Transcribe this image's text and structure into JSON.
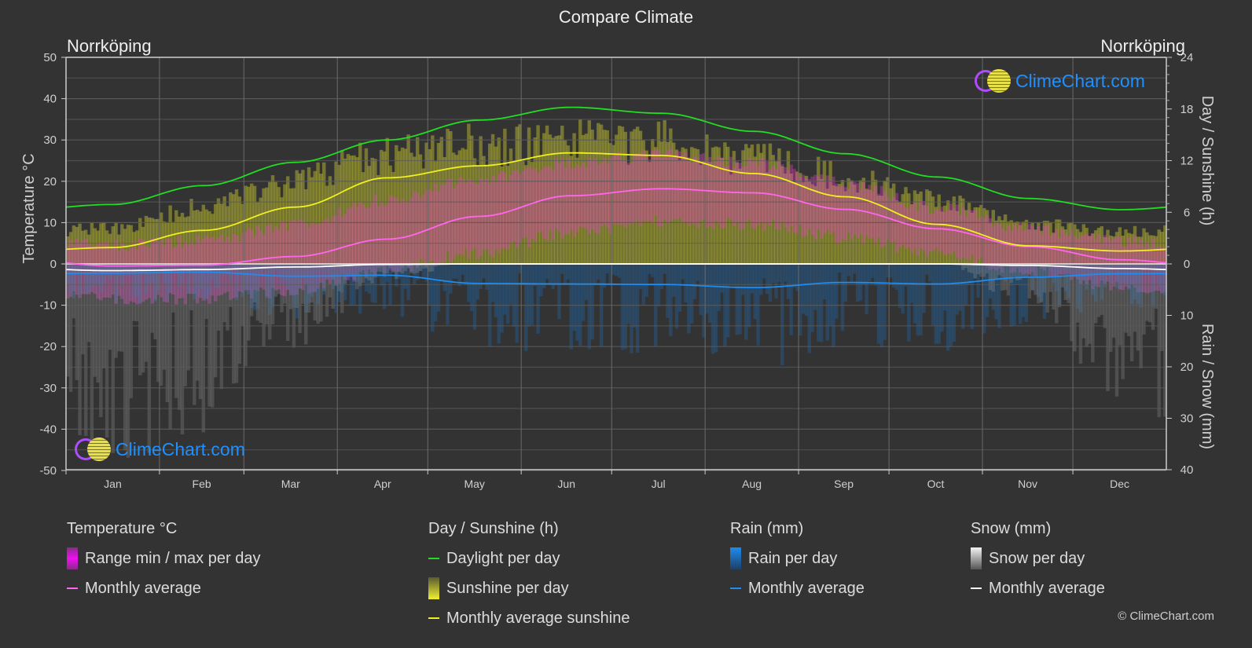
{
  "page": {
    "title": "Compare Climate",
    "location_left": "Norrköping",
    "location_right": "Norrköping",
    "logo_text": "ClimeChart.com",
    "copyright": "© ClimeChart.com"
  },
  "legend": {
    "temperature": {
      "header": "Temperature °C",
      "items": [
        {
          "label": "Range min / max per day",
          "kind": "bar",
          "color": "#e619e6"
        },
        {
          "label": "Monthly average",
          "kind": "line",
          "color": "#ff66ee"
        }
      ]
    },
    "sunshine": {
      "header": "Day / Sunshine (h)",
      "items": [
        {
          "label": "Daylight per day",
          "kind": "line",
          "color": "#22dd22"
        },
        {
          "label": "Sunshine per day",
          "kind": "bar",
          "color": "#e6e630"
        },
        {
          "label": "Monthly average sunshine",
          "kind": "line",
          "color": "#f0f020"
        }
      ]
    },
    "rain": {
      "header": "Rain (mm)",
      "items": [
        {
          "label": "Rain per day",
          "kind": "bar",
          "color": "#1e8cf0"
        },
        {
          "label": "Monthly average",
          "kind": "line",
          "color": "#1e8cf0"
        }
      ]
    },
    "snow": {
      "header": "Snow (mm)",
      "items": [
        {
          "label": "Snow per day",
          "kind": "bar",
          "color": "#e0e0e0"
        },
        {
          "label": "Monthly average",
          "kind": "line",
          "color": "#ffffff"
        }
      ]
    }
  },
  "chart_data": {
    "type": "line",
    "title": "Compare Climate",
    "categories": [
      "Jan",
      "Feb",
      "Mar",
      "Apr",
      "May",
      "Jun",
      "Jul",
      "Aug",
      "Sep",
      "Oct",
      "Nov",
      "Dec"
    ],
    "axes": {
      "left": {
        "label": "Temperature °C",
        "range": [
          -50,
          50
        ],
        "ticks": [
          50,
          40,
          30,
          20,
          10,
          0,
          -10,
          -20,
          -30,
          -40,
          -50
        ]
      },
      "right_top": {
        "label": "Day / Sunshine (h)",
        "range": [
          0,
          24
        ],
        "ticks": [
          24,
          18,
          12,
          6,
          0
        ]
      },
      "right_bottom": {
        "label": "Rain / Snow (mm)",
        "range": [
          0,
          40
        ],
        "ticks": [
          0,
          10,
          20,
          30,
          40
        ]
      }
    },
    "grid": true,
    "series": [
      {
        "name": "Temperature monthly average",
        "axis": "left",
        "color": "#ff66ee",
        "values": [
          -0.5,
          -0.3,
          1.8,
          6.0,
          11.5,
          16.5,
          18.2,
          17.2,
          13.2,
          8.5,
          4.2,
          1.0
        ]
      },
      {
        "name": "Daylight per day",
        "axis": "right_top",
        "color": "#22dd22",
        "values": [
          6.9,
          9.1,
          11.8,
          14.4,
          16.7,
          18.2,
          17.5,
          15.4,
          12.8,
          10.1,
          7.6,
          6.3
        ]
      },
      {
        "name": "Monthly average sunshine",
        "axis": "right_top",
        "color": "#f0f020",
        "values": [
          1.9,
          3.9,
          6.6,
          10.0,
          11.4,
          12.9,
          12.6,
          10.5,
          7.8,
          4.6,
          2.1,
          1.5
        ]
      },
      {
        "name": "Rain monthly average",
        "axis": "right_bottom",
        "color": "#1e8cf0",
        "values": [
          1.8,
          1.6,
          2.4,
          2.2,
          3.8,
          3.9,
          4.0,
          4.6,
          3.6,
          3.9,
          2.6,
          1.9
        ]
      },
      {
        "name": "Snow monthly average",
        "axis": "right_bottom",
        "color": "#ffffff",
        "values": [
          1.3,
          1.1,
          0.6,
          0.1,
          0,
          0,
          0,
          0,
          0,
          0,
          0.3,
          0.9
        ]
      }
    ],
    "bands": {
      "temperature_range_approx": {
        "min": [
          -7,
          -7,
          -5,
          0,
          4,
          9,
          12,
          11,
          8,
          4,
          0,
          -4
        ],
        "max": [
          3,
          4,
          8,
          14,
          19,
          23,
          25,
          23,
          18,
          12,
          7,
          4
        ]
      },
      "sunshine_max_approx": [
        4.5,
        7.0,
        10.5,
        13.5,
        15.0,
        15.5,
        15.3,
        13.5,
        11.0,
        7.8,
        5.0,
        4.0
      ]
    }
  }
}
